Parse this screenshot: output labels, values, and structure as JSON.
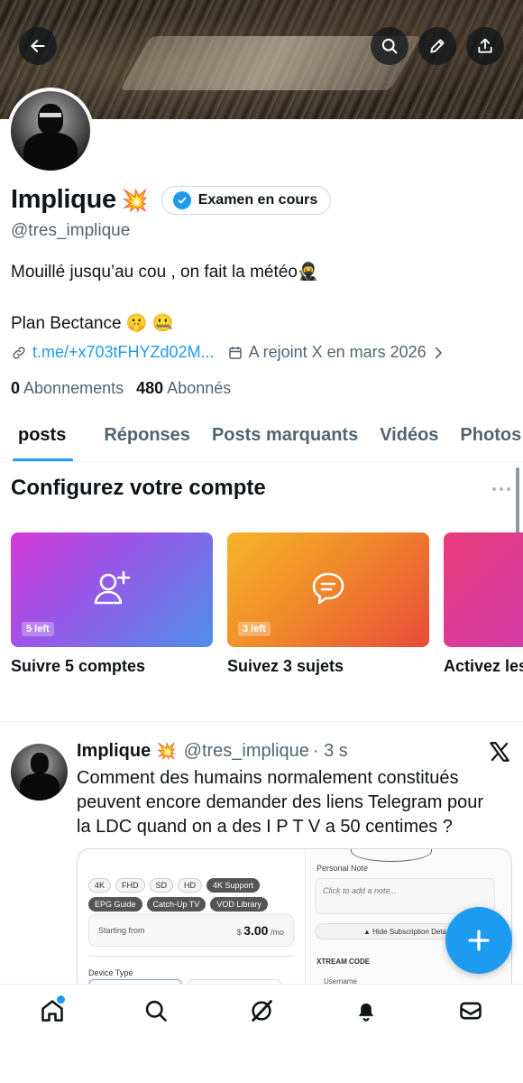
{
  "profile": {
    "display_name": "Implique",
    "name_emoji": "💥",
    "verification_label": "Examen en cours",
    "handle": "@tres_implique",
    "bio_line1": "Mouillé jusqu’au cou , on fait la météo🥷",
    "bio_line2": "Plan Bectance 🤫 🤐",
    "link": "t.me/+x703tFHYZd02M...",
    "joined": "A rejoint X en mars 2026",
    "following_count": "0",
    "following_label": "Abonnements",
    "followers_count": "480",
    "followers_label": "Abonnés"
  },
  "tabs": [
    "posts",
    "Réponses",
    "Posts marquants",
    "Vidéos",
    "Photos"
  ],
  "setup": {
    "title": "Configurez votre compte",
    "cards": [
      {
        "badge": "5 left",
        "label": "Suivre 5 comptes",
        "icon": "add-user-icon"
      },
      {
        "badge": "3 left",
        "label": "Suivez 3 sujets",
        "icon": "topic-bubble-icon"
      },
      {
        "badge": "",
        "label": "Activez les",
        "icon": ""
      }
    ]
  },
  "post": {
    "author": "Implique",
    "emoji": "💥",
    "handle": "@tres_implique",
    "time": "· 3 s",
    "text": "Comment des humains normalement constitués peuvent encore demander des liens Telegram pour la LDC quand on a des I P T V a 50 centimes ?",
    "media": {
      "chips": [
        "4K",
        "FHD",
        "SD",
        "HD",
        "4K Support",
        "EPG Guide",
        "Catch-Up TV",
        "VOD Library"
      ],
      "starting_from": "Starting from",
      "price_currency": "$",
      "price": "3.00",
      "price_unit": "/mo",
      "device_type": "Device Type",
      "personal_note": "Personal Note",
      "note_placeholder": "Click to add a note...",
      "hide_button": "Hide Subscription Deta",
      "xtream": "XTREAM CODE",
      "username": "Username"
    }
  },
  "colors": {
    "accent": "#1d9bf0",
    "text": "#0f1419",
    "muted": "#536471"
  },
  "nav": [
    "home-icon",
    "search-icon",
    "grok-icon",
    "notifications-icon",
    "messages-icon"
  ]
}
